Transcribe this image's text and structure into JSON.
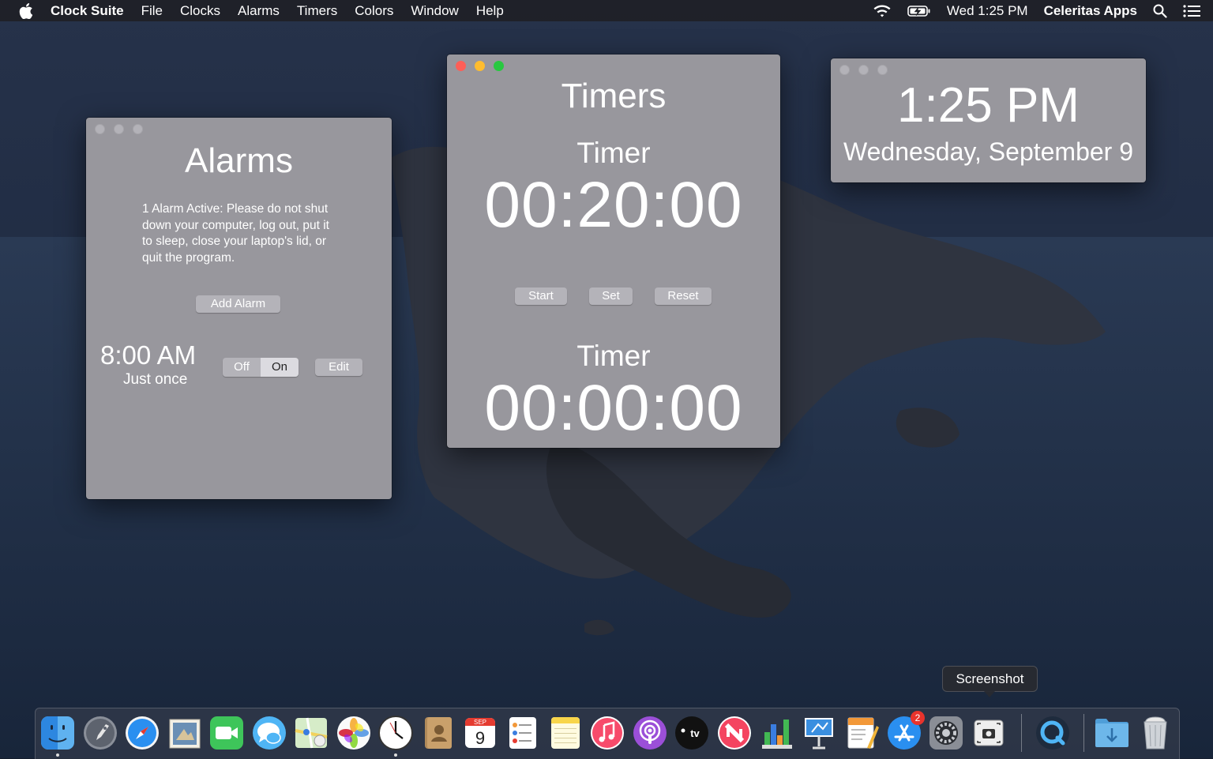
{
  "menubar": {
    "app_name": "Clock Suite",
    "menus": [
      "File",
      "Clocks",
      "Alarms",
      "Timers",
      "Colors",
      "Window",
      "Help"
    ],
    "clock": "Wed 1:25 PM",
    "user": "Celeritas Apps"
  },
  "alarms_window": {
    "title": "Alarms",
    "notice": "1 Alarm Active: Please do not shut down your computer, log out, put it to sleep, close your laptop's lid, or quit the program.",
    "add_button": "Add Alarm",
    "alarm": {
      "time": "8:00 AM",
      "repeat": "Just once",
      "off_label": "Off",
      "on_label": "On",
      "edit_label": "Edit"
    }
  },
  "timers_window": {
    "title": "Timers",
    "timer1": {
      "label": "Timer",
      "value": "00:20:00"
    },
    "buttons": {
      "start": "Start",
      "set": "Set",
      "reset": "Reset"
    },
    "timer2": {
      "label": "Timer",
      "value": "00:00:00"
    }
  },
  "clock_window": {
    "time": "1:25 PM",
    "date": "Wednesday, September 9"
  },
  "tooltip": "Screenshot",
  "dock": {
    "calendar_month": "SEP",
    "calendar_day": "9",
    "appstore_badge": "2",
    "tv_label": "tv"
  },
  "colors": {
    "window_bg": "#98979d",
    "button_bg": "#b4b3b9",
    "close": "#fe5f57",
    "minimize": "#febc2e",
    "maximize": "#28c840"
  }
}
